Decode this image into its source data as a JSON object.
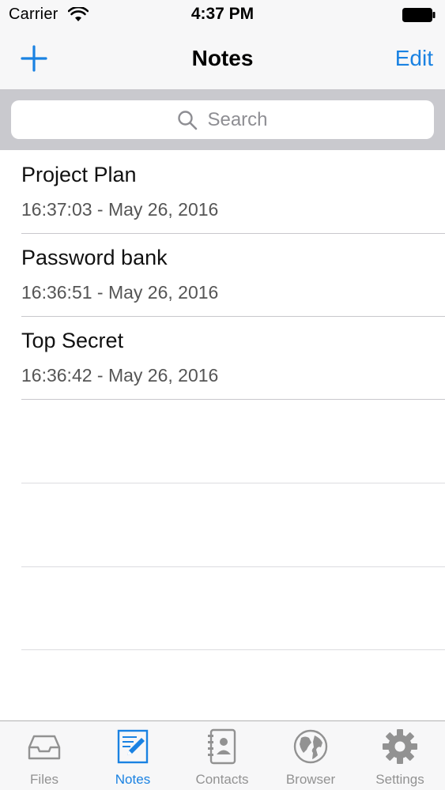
{
  "status_bar": {
    "carrier": "Carrier",
    "time": "4:37 PM"
  },
  "nav": {
    "title": "Notes",
    "edit_label": "Edit",
    "add_icon": "plus-icon"
  },
  "search": {
    "placeholder": "Search"
  },
  "notes": [
    {
      "title": "Project Plan",
      "timestamp": "16:37:03 - May 26, 2016"
    },
    {
      "title": "Password bank",
      "timestamp": "16:36:51 - May 26, 2016"
    },
    {
      "title": "Top Secret",
      "timestamp": "16:36:42 - May 26, 2016"
    }
  ],
  "tabs": [
    {
      "label": "Files",
      "icon": "tray-icon",
      "active": false
    },
    {
      "label": "Notes",
      "icon": "note-edit-icon",
      "active": true
    },
    {
      "label": "Contacts",
      "icon": "address-book-icon",
      "active": false
    },
    {
      "label": "Browser",
      "icon": "globe-icon",
      "active": false
    },
    {
      "label": "Settings",
      "icon": "gear-icon",
      "active": false
    }
  ],
  "colors": {
    "accent": "#1a82e2",
    "inactive_tab": "#929292",
    "bar_background": "#f7f7f8",
    "search_background": "#c9c9ce"
  }
}
